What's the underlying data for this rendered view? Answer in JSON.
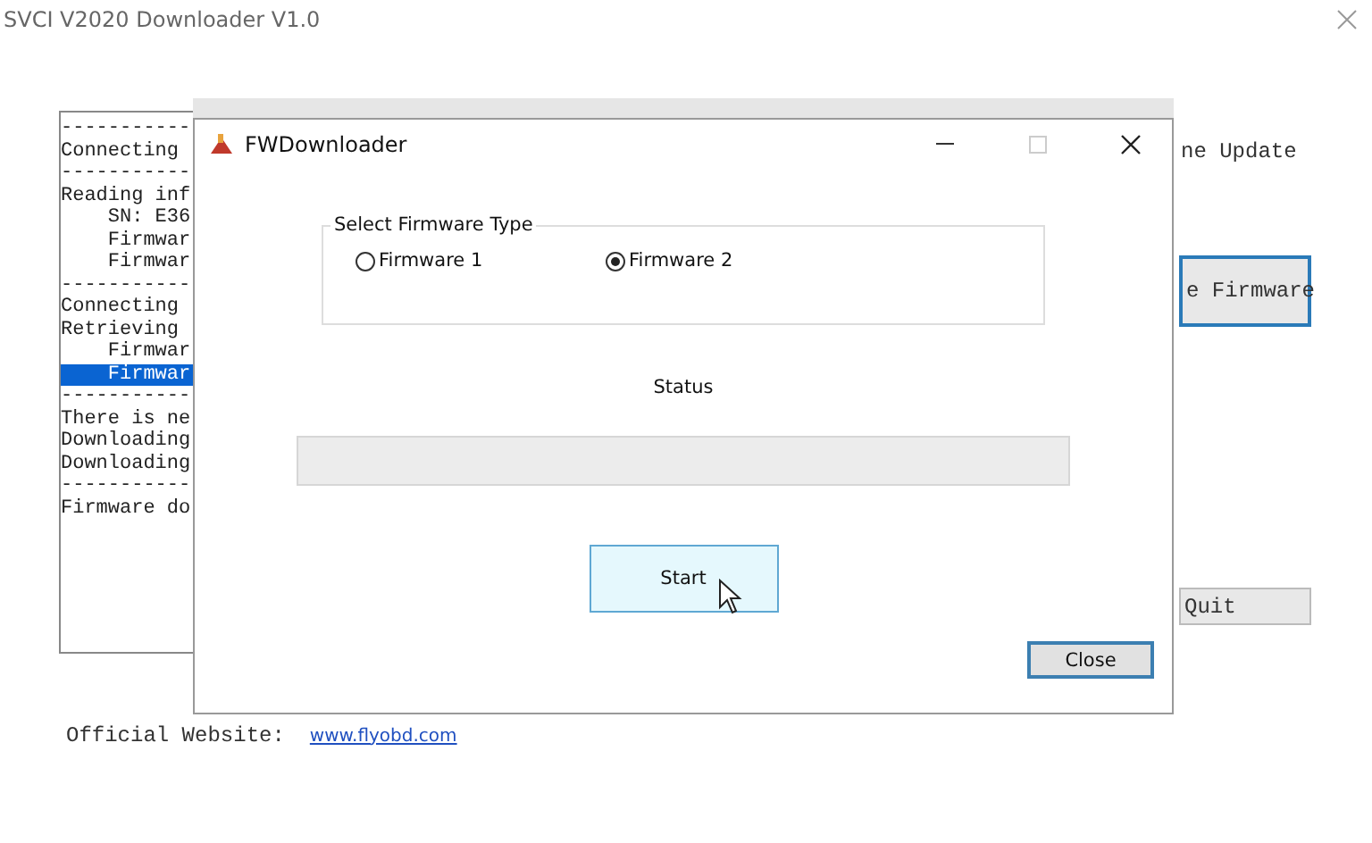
{
  "window": {
    "title": "SVCI V2020 Downloader V1.0"
  },
  "log": {
    "lines": [
      {
        "text": "-----------",
        "selected": false
      },
      {
        "text": "Connecting",
        "selected": false
      },
      {
        "text": "-----------",
        "selected": false
      },
      {
        "text": "Reading inf",
        "selected": false
      },
      {
        "text": "    SN: E36",
        "selected": false
      },
      {
        "text": "    Firmwar",
        "selected": false
      },
      {
        "text": "    Firmwar",
        "selected": false
      },
      {
        "text": "-----------",
        "selected": false
      },
      {
        "text": "Connecting",
        "selected": false
      },
      {
        "text": "Retrieving",
        "selected": false
      },
      {
        "text": "    Firmwar",
        "selected": false
      },
      {
        "text": "    Firmwar",
        "selected": true
      },
      {
        "text": "-----------",
        "selected": false
      },
      {
        "text": "There is ne",
        "selected": false
      },
      {
        "text": "Downloading",
        "selected": false
      },
      {
        "text": "Downloading",
        "selected": false
      },
      {
        "text": "-----------",
        "selected": false
      },
      {
        "text": "Firmware do",
        "selected": false
      }
    ]
  },
  "side": {
    "label": "ne Update",
    "buttons": [
      {
        "label": "e Firmware",
        "focused": true
      },
      {
        "label": "Quit",
        "focused": false
      }
    ]
  },
  "footer": {
    "label": "Official Website:",
    "link": "www.flyobd.com"
  },
  "dialog": {
    "title": "FWDownloader",
    "group": {
      "title": "Select Firmware Type",
      "options": [
        {
          "label": "Firmware 1",
          "selected": false
        },
        {
          "label": "Firmware 2",
          "selected": true
        }
      ]
    },
    "status_label": "Status",
    "progress": {
      "level": 0
    },
    "buttons": [
      {
        "label": "Start",
        "hovered": true,
        "default": false
      },
      {
        "label": "Close",
        "hovered": false,
        "default": true
      }
    ]
  }
}
